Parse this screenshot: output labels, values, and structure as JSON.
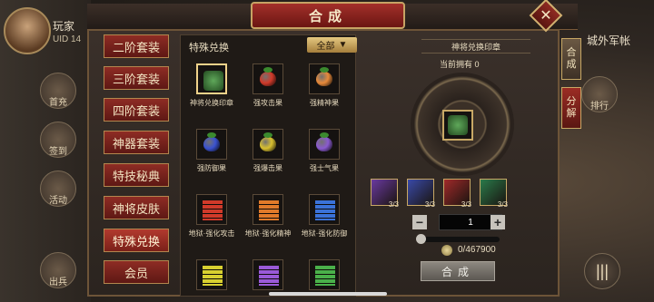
{
  "player": {
    "name": "玩家",
    "uid_label": "UID 14"
  },
  "side_menu": [
    "首充",
    "签到",
    "活动",
    "出兵"
  ],
  "right_bg": {
    "city": "城外军帐",
    "rank": "排行",
    "menu_glyph": "|||"
  },
  "window": {
    "title": "合成",
    "close_glyph": "✕"
  },
  "categories": [
    {
      "label": "二阶套装",
      "active": false
    },
    {
      "label": "三阶套装",
      "active": false
    },
    {
      "label": "四阶套装",
      "active": false
    },
    {
      "label": "神器套装",
      "active": false
    },
    {
      "label": "特技秘典",
      "active": false
    },
    {
      "label": "神将皮肤",
      "active": false
    },
    {
      "label": "特殊兑换",
      "active": true
    },
    {
      "label": "会员",
      "active": false
    }
  ],
  "list": {
    "title": "特殊兑换",
    "filter": "全部",
    "filter_icon": "▼"
  },
  "items": [
    {
      "label": "神将兑换印章",
      "kind": "seal",
      "color": "#5fa85a",
      "selected": true
    },
    {
      "label": "强攻击果",
      "kind": "fruit",
      "color": "#d03a2a"
    },
    {
      "label": "强精神果",
      "kind": "fruit",
      "color": "#e88a3a"
    },
    {
      "label": "强防御果",
      "kind": "fruit",
      "color": "#3a52d0"
    },
    {
      "label": "强爆击果",
      "kind": "fruit",
      "color": "#d8c030"
    },
    {
      "label": "强士气果",
      "kind": "fruit",
      "color": "#8a5ad0"
    },
    {
      "label": "地狱·强化攻击",
      "kind": "book",
      "color": "#d03a2a"
    },
    {
      "label": "地狱·强化精神",
      "kind": "book",
      "color": "#e07a2a"
    },
    {
      "label": "地狱·强化防御",
      "kind": "book",
      "color": "#3a72d8"
    },
    {
      "label": "",
      "kind": "book",
      "color": "#d8d030"
    },
    {
      "label": "",
      "kind": "book",
      "color": "#9a5ad8"
    },
    {
      "label": "",
      "kind": "book",
      "color": "#4ab04a"
    }
  ],
  "detail": {
    "name": "神将兑换印章",
    "owned": "当前拥有 0",
    "materials": [
      {
        "count": "3/3",
        "color": "#6a3aa0"
      },
      {
        "count": "3/3",
        "color": "#3a4aa8"
      },
      {
        "count": "3/3",
        "color": "#a02a2a"
      },
      {
        "count": "3/3",
        "color": "#2a7a4a"
      }
    ],
    "minus": "−",
    "plus": "+",
    "quantity": "1",
    "cost": "0/467900",
    "craft_label": "合成"
  },
  "tabs": [
    {
      "label": "合成",
      "active": true
    },
    {
      "label": "分解",
      "active": false
    }
  ]
}
